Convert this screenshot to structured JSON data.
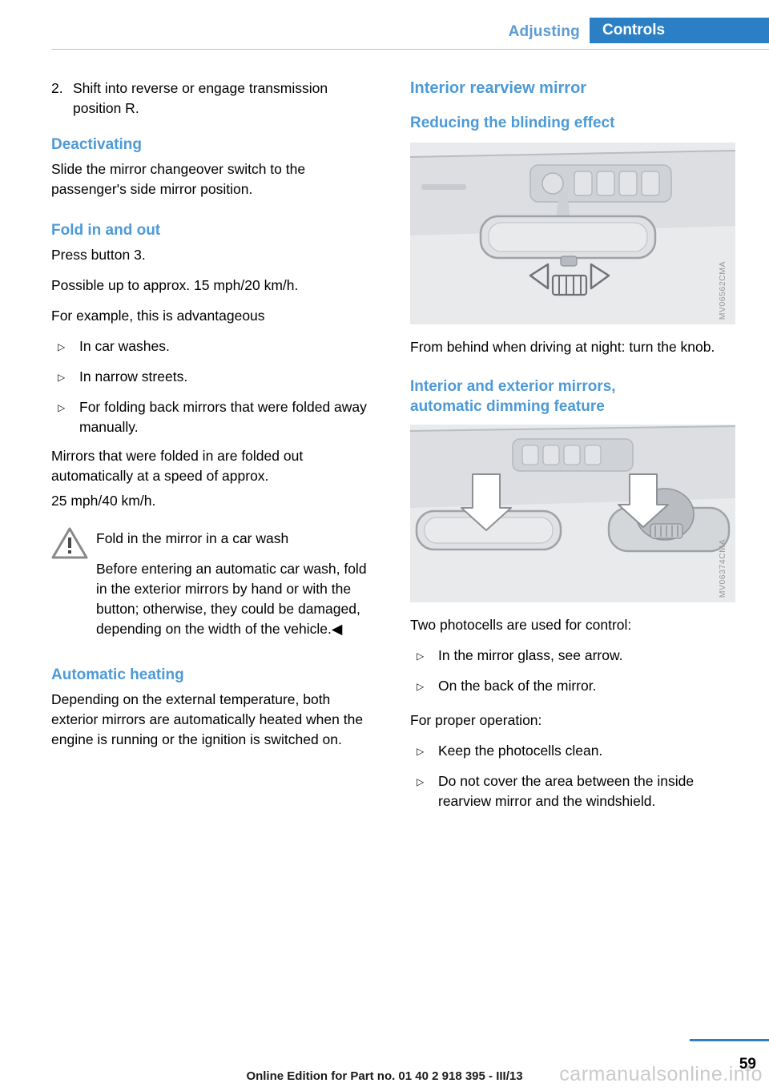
{
  "header": {
    "tab_secondary": "Adjusting",
    "tab_primary": "Controls",
    "accent_color": "#2b7fc4",
    "secondary_color": "#5b9bd5"
  },
  "left_column": {
    "step": {
      "number": "2.",
      "text": "Shift into reverse or engage transmission position R."
    },
    "deactivating": {
      "heading": "Deactivating",
      "body": "Slide the mirror changeover switch to the passenger's side mirror position."
    },
    "fold": {
      "heading": "Fold in and out",
      "p1": "Press button 3.",
      "p2": "Possible up to approx. 15 mph/20 km/h.",
      "p3": "For example, this is advantageous",
      "bullets": [
        "In car washes.",
        "In narrow streets.",
        "For folding back mirrors that were folded away manually."
      ],
      "p4": "Mirrors that were folded in are folded out automatically at a speed of approx.",
      "p5": "25 mph/40 km/h."
    },
    "warning": {
      "title": "Fold in the mirror in a car wash",
      "body": "Before entering an automatic car wash, fold in the exterior mirrors by hand or with the button; otherwise, they could be damaged, depending on the width of the vehicle.◀"
    },
    "heating": {
      "heading": "Automatic heating",
      "body": "Depending on the external temperature, both exterior mirrors are automatically heated when the engine is running or the ignition is switched on."
    }
  },
  "right_column": {
    "title": "Interior rearview mirror",
    "reducing": {
      "heading": "Reducing the blinding effect",
      "figure_code": "MV06562CMA",
      "caption": "From behind when driving at night: turn the knob."
    },
    "dimming": {
      "heading_line1": "Interior and exterior mirrors,",
      "heading_line2": "automatic dimming feature",
      "figure_code": "MV06374CMA",
      "p1": "Two photocells are used for control:",
      "bullets1": [
        "In the mirror glass, see arrow.",
        "On the back of the mirror."
      ],
      "p2": "For proper operation:",
      "bullets2": [
        "Keep the photocells clean.",
        "Do not cover the area between the inside rearview mirror and the windshield."
      ]
    }
  },
  "footer": {
    "page_number": "59",
    "edition_note": "Online Edition for Part no. 01 40 2 918 395 - III/13",
    "watermark": "carmanualsonline.info"
  }
}
